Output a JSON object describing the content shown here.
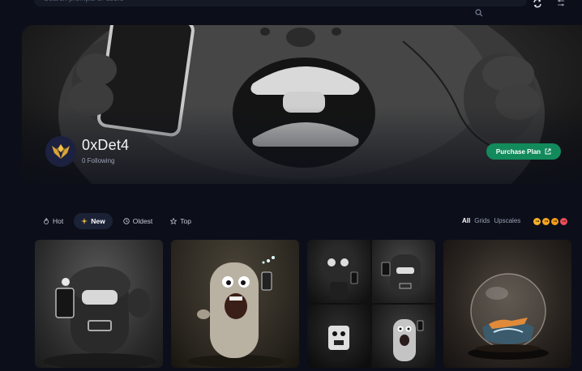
{
  "search": {
    "placeholder": "Search prompts or users"
  },
  "profile": {
    "name": "0xDet4",
    "following": "0 Following",
    "purchase_label": "Purchase Plan"
  },
  "tabs": [
    {
      "label": "Hot",
      "icon": "flame-icon",
      "active": false
    },
    {
      "label": "New",
      "icon": "sparkle-icon",
      "active": true
    },
    {
      "label": "Oldest",
      "icon": "clock-icon",
      "active": false
    },
    {
      "label": "Top",
      "icon": "star-icon",
      "active": false
    }
  ],
  "views": [
    {
      "label": "All",
      "active": true
    },
    {
      "label": "Grids",
      "active": false
    },
    {
      "label": "Upscales",
      "active": false
    }
  ],
  "reactions": [
    {
      "icon": "neutral-emoji-icon",
      "color": "#f5b32a"
    },
    {
      "icon": "smile-emoji-icon",
      "color": "#f5a623"
    },
    {
      "icon": "laugh-emoji-icon",
      "color": "#f29b1d"
    },
    {
      "icon": "love-emoji-icon",
      "color": "#ef4c5c"
    }
  ],
  "colors": {
    "accent": "#138a5c",
    "background": "#0c0f1a",
    "tab_active_bg": "#1c2236"
  }
}
